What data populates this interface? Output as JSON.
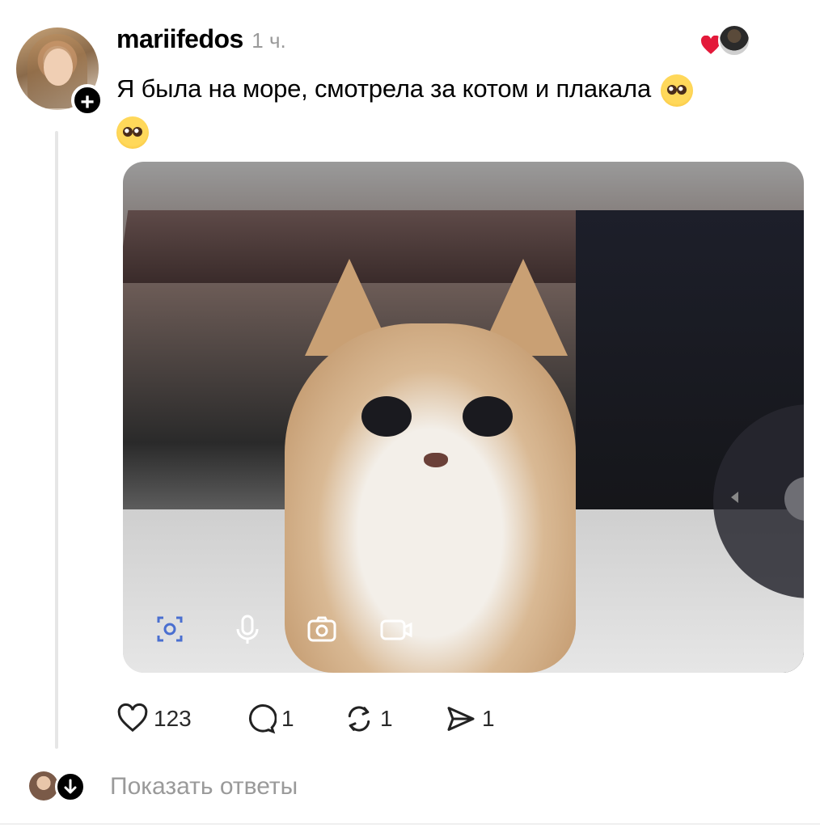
{
  "post": {
    "username": "mariifedos",
    "time": "1 ч.",
    "text": "Я была на море, смотрела за котом и плакала",
    "text_emojis": [
      "pleading-face",
      "pleading-face"
    ],
    "media_icons": [
      "scan-icon",
      "microphone-icon",
      "camera-icon",
      "video-icon"
    ]
  },
  "actions": {
    "likes": "123",
    "comments": "1",
    "reposts": "1",
    "shares": "1"
  },
  "replies": {
    "label": "Показать ответы"
  },
  "colors": {
    "heart": "#e3193a",
    "muted_text": "#9a9a9a",
    "thread_line": "#e6e6e6"
  }
}
